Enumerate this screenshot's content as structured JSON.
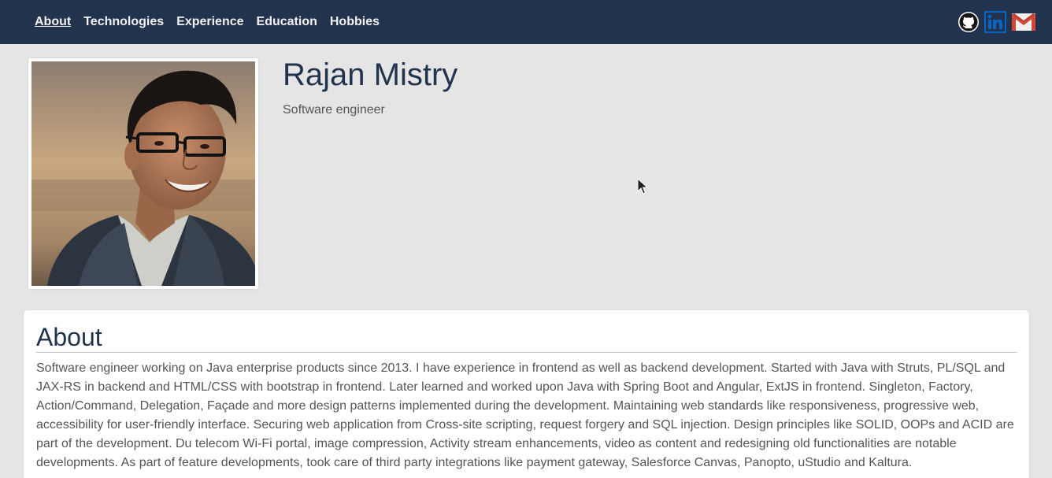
{
  "nav": {
    "items": [
      {
        "label": "About",
        "active": true
      },
      {
        "label": "Technologies",
        "active": false
      },
      {
        "label": "Experience",
        "active": false
      },
      {
        "label": "Education",
        "active": false
      },
      {
        "label": "Hobbies",
        "active": false
      }
    ],
    "social_icons": [
      "github-icon",
      "linkedin-icon",
      "gmail-icon"
    ]
  },
  "profile": {
    "name": "Rajan Mistry",
    "title": "Software engineer"
  },
  "about": {
    "heading": "About",
    "text": "Software engineer working on Java enterprise products since 2013. I have experience in frontend as well as backend development. Started with Java with Struts, PL/SQL and JAX-RS in backend and HTML/CSS with bootstrap in frontend. Later learned and worked upon Java with Spring Boot and Angular, ExtJS in frontend. Singleton, Factory, Action/Command, Delegation, Façade and more design patterns implemented during the development. Maintaining web standards like responsiveness, progressive web, accessibility for user-friendly interface. Securing web application from Cross-site scripting, request forgery and SQL injection. Design principles like SOLID, OOPs and ACID are part of the development. Du telecom Wi-Fi portal, image compression, Activity stream enhancements, video as content and redesigning old functionalities are notable developments. As part of feature developments, took care of third party integrations like payment gateway, Salesforce Canvas, Panopto, uStudio and Kaltura."
  },
  "colors": {
    "navbar": "#22344d",
    "page_bg": "#e5e5e5",
    "heading": "#22344d",
    "linkedin": "#0a66c2",
    "gmail_red": "#d44638"
  }
}
